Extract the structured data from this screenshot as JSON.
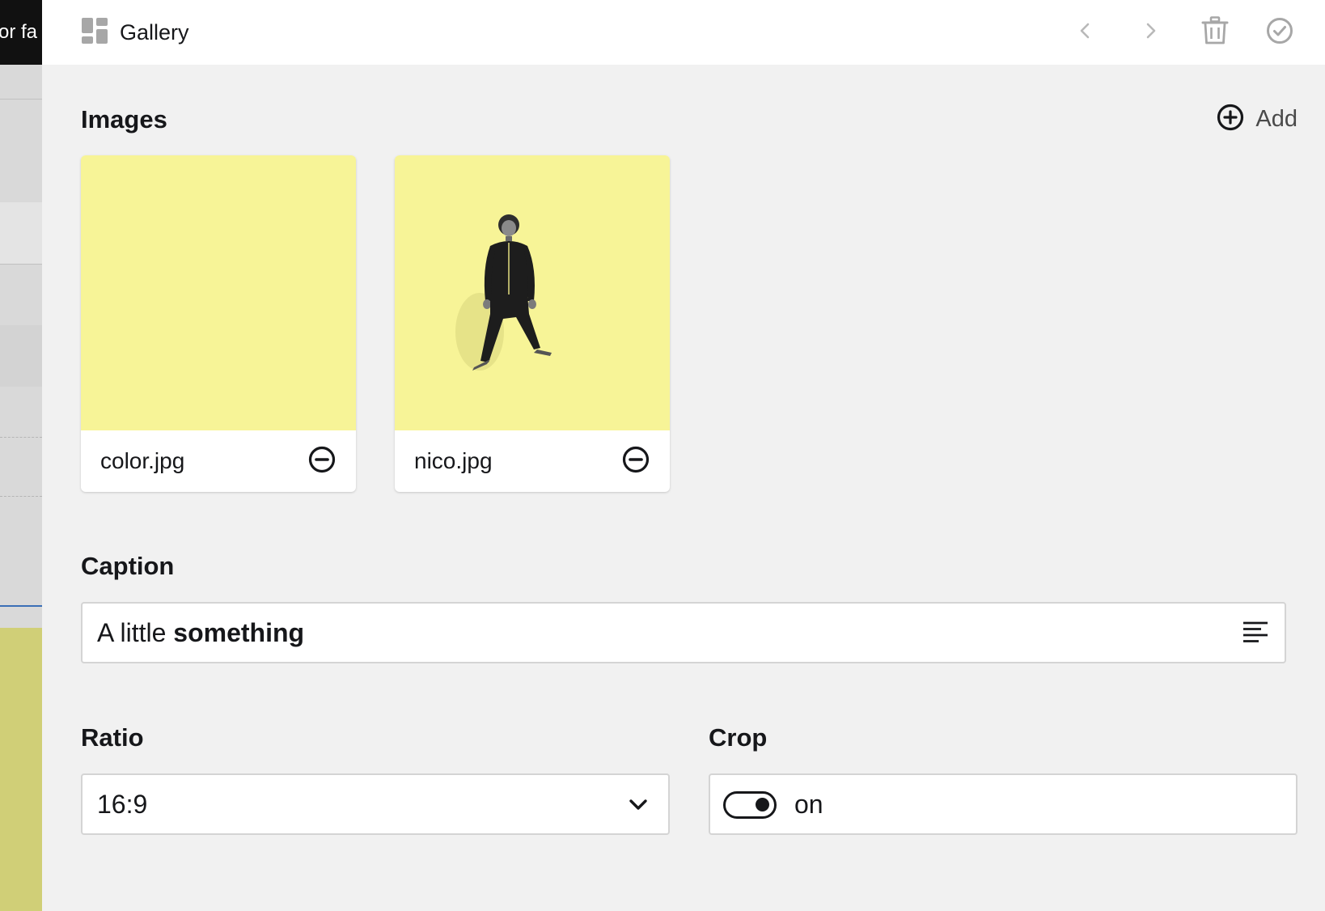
{
  "background": {
    "topbar_text": "or fa"
  },
  "drawer": {
    "icon": "grid-blocks-icon",
    "title": "Gallery",
    "actions": {
      "prev_icon": "chevron-left-icon",
      "next_icon": "chevron-right-icon",
      "delete_icon": "trash-icon",
      "confirm_icon": "check-circle-icon"
    }
  },
  "images": {
    "label": "Images",
    "add_label": "Add",
    "add_icon": "plus-circle-icon",
    "items": [
      {
        "filename": "color.jpg",
        "remove_icon": "minus-circle-icon",
        "thumb_color": "#f7f497"
      },
      {
        "filename": "nico.jpg",
        "remove_icon": "minus-circle-icon",
        "thumb_color": "#f7f497"
      }
    ]
  },
  "caption": {
    "label": "Caption",
    "value_plain": "A little ",
    "value_bold": "something",
    "toolbar_icon": "text-align-left-icon"
  },
  "ratio": {
    "label": "Ratio",
    "value": "16:9",
    "icon": "chevron-down-icon"
  },
  "crop": {
    "label": "Crop",
    "value": "on",
    "checked": true
  },
  "colors": {
    "accent_yellow": "#f7f497",
    "text": "#16171a",
    "drawer_bg": "#f1f1f1"
  }
}
